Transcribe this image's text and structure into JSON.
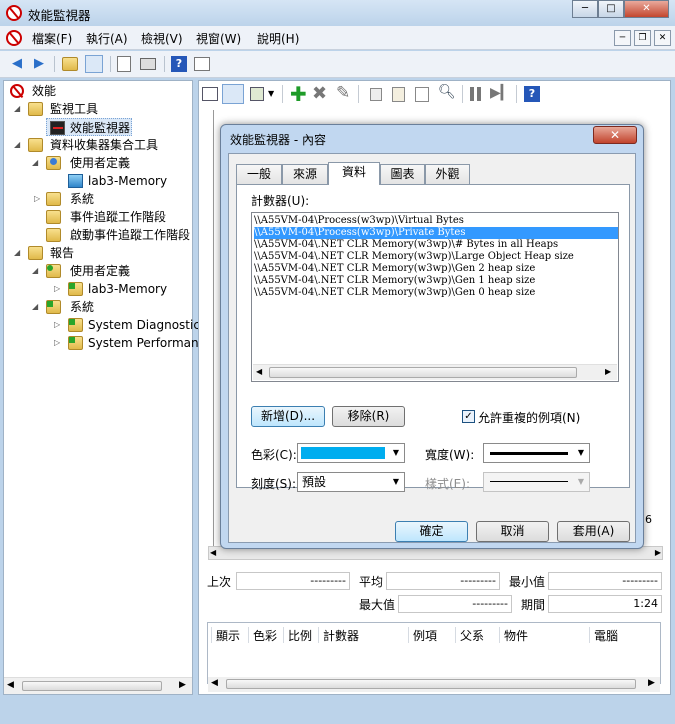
{
  "window": {
    "title": "效能監視器",
    "minimize": "─",
    "maximize": "□",
    "close": "✕"
  },
  "menu": {
    "items": [
      "檔案(F)",
      "執行(A)",
      "檢視(V)",
      "視窗(W)",
      "說明(H)"
    ],
    "mdi_min": "─",
    "mdi_restore": "❐",
    "mdi_close": "✕"
  },
  "toolbar": {
    "back": "◀",
    "forward": "▶",
    "help": "?"
  },
  "tree": {
    "root": "效能",
    "monitoring_tools": "監視工具",
    "perf_monitor": "效能監視器",
    "dcs": "資料收集器集合工具",
    "user_defined": "使用者定義",
    "lab3": "lab3-Memory",
    "system": "系統",
    "event_trace": "事件追蹤工作階段",
    "startup_trace": "啟動事件追蹤工作階段",
    "reports": "報告",
    "r_user_defined": "使用者定義",
    "r_lab3": "lab3-Memory",
    "r_system": "系統",
    "sys_diag": "System Diagnostic",
    "sys_perf": "System Performan"
  },
  "stats": {
    "last_label": "上次",
    "last_value": "---------",
    "avg_label": "平均",
    "avg_value": "---------",
    "min_label": "最小值",
    "min_value": "---------",
    "max_label": "最大值",
    "max_value": "---------",
    "duration_label": "期間",
    "duration_value": "1:24",
    "axis_edge": "6"
  },
  "legend": {
    "headers": [
      "顯示",
      "色彩",
      "比例",
      "計數器",
      "例項",
      "父系",
      "物件",
      "電腦"
    ]
  },
  "dialog": {
    "title": "效能監視器 - 內容",
    "close": "✕",
    "tabs": [
      "一般",
      "來源",
      "資料",
      "圖表",
      "外觀"
    ],
    "active_tab": "資料",
    "counters_label": "計數器(U):",
    "counters": [
      "\\\\A55VM-04\\Process(w3wp)\\Virtual Bytes",
      "\\\\A55VM-04\\Process(w3wp)\\Private Bytes",
      "\\\\A55VM-04\\.NET CLR Memory(w3wp)\\# Bytes in all Heaps",
      "\\\\A55VM-04\\.NET CLR Memory(w3wp)\\Large Object Heap size",
      "\\\\A55VM-04\\.NET CLR Memory(w3wp)\\Gen 2 heap size",
      "\\\\A55VM-04\\.NET CLR Memory(w3wp)\\Gen 1 heap size",
      "\\\\A55VM-04\\.NET CLR Memory(w3wp)\\Gen 0 heap size"
    ],
    "selected_index": 1,
    "add_button": "新增(D)...",
    "remove_button": "移除(R)",
    "allow_duplicates_label": "允許重複的例項(N)",
    "allow_duplicates_checked": true,
    "check_mark": "✓",
    "color_label": "色彩(C):",
    "color_value": "#00adef",
    "width_label": "寬度(W):",
    "scale_label": "刻度(S):",
    "scale_value": "預設",
    "style_label": "樣式(E):",
    "ok_button": "確定",
    "cancel_button": "取消",
    "apply_button": "套用(A)"
  }
}
